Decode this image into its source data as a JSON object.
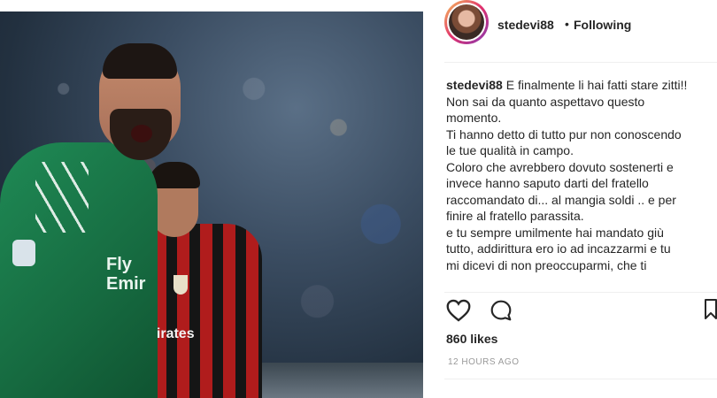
{
  "post": {
    "username": "stedevi88",
    "follow_separator": "•",
    "follow_status": "Following",
    "caption_user": "stedevi88",
    "caption_lines": [
      "E finalmente li hai fatti stare zitti!!",
      "Non sai da quanto aspettavo questo",
      "momento.",
      "Ti hanno detto di tutto pur non conoscendo",
      "le tue qualità in campo.",
      "Coloro che avrebbero dovuto sostenerti e",
      "invece hanno saputo darti del fratello",
      "raccomandato di... al mangia soldi .. e per",
      "finire al fratello parassita.",
      "e tu sempre umilmente hai mandato giù",
      "tutto, addirittura ero io ad incazzarmi e tu",
      "mi dicevi di non preoccuparmi, che ti"
    ],
    "likes": "860 likes",
    "timestamp": "12 HOURS AGO"
  },
  "photo": {
    "keeper_sponsor": "Fly\nEmir",
    "outfield_sponsor": "Fly\nEmirates"
  },
  "icons": [
    "heart-icon",
    "comment-icon",
    "bookmark-icon"
  ]
}
